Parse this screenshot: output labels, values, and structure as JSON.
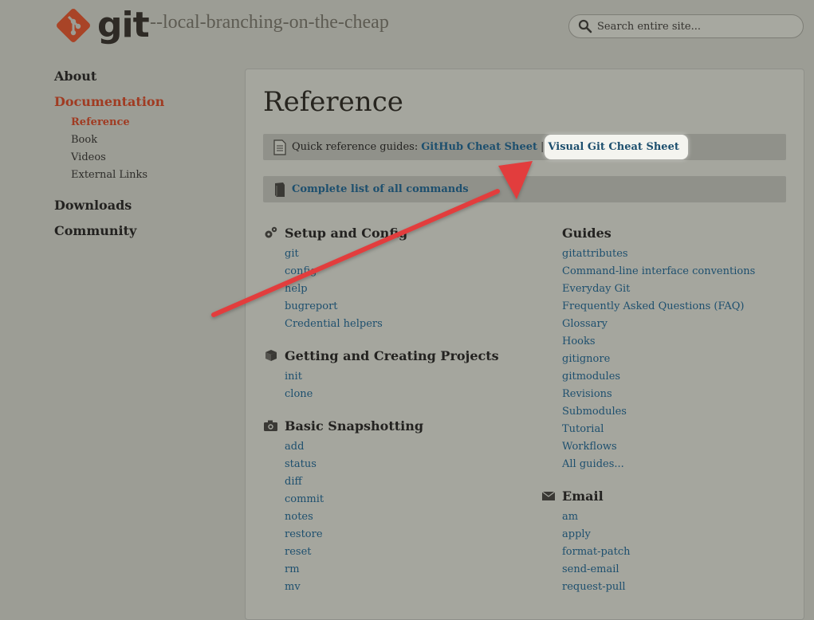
{
  "header": {
    "logo_text": "git",
    "tagline": "--local-branching-on-the-cheap",
    "search_placeholder": "Search entire site..."
  },
  "sidebar": {
    "about": "About",
    "documentation": "Documentation",
    "sub": {
      "reference": "Reference",
      "book": "Book",
      "videos": "Videos",
      "external_links": "External Links"
    },
    "downloads": "Downloads",
    "community": "Community"
  },
  "main": {
    "title": "Reference",
    "quickref_label": "Quick reference guides:",
    "github_cheat_sheet": "GitHub Cheat Sheet",
    "separator": "|",
    "visual_cheat_sheet": "Visual Git Cheat Sheet",
    "complete_list": "Complete list of all commands",
    "sections": {
      "setup": {
        "title": "Setup and Config",
        "items": [
          "git",
          "config",
          "help",
          "bugreport",
          "Credential helpers"
        ]
      },
      "getting": {
        "title": "Getting and Creating Projects",
        "items": [
          "init",
          "clone"
        ]
      },
      "basic": {
        "title": "Basic Snapshotting",
        "items": [
          "add",
          "status",
          "diff",
          "commit",
          "notes",
          "restore",
          "reset",
          "rm",
          "mv"
        ]
      },
      "guides": {
        "title": "Guides",
        "items": [
          "gitattributes",
          "Command-line interface conventions",
          "Everyday Git",
          "Frequently Asked Questions (FAQ)",
          "Glossary",
          "Hooks",
          "gitignore",
          "gitmodules",
          "Revisions",
          "Submodules",
          "Tutorial",
          "Workflows",
          "All guides..."
        ]
      },
      "email": {
        "title": "Email",
        "items": [
          "am",
          "apply",
          "format-patch",
          "send-email",
          "request-pull"
        ]
      }
    }
  },
  "colors": {
    "accent": "#a03b22",
    "link": "#1d4f6e",
    "arrow": "#e23d3d"
  }
}
